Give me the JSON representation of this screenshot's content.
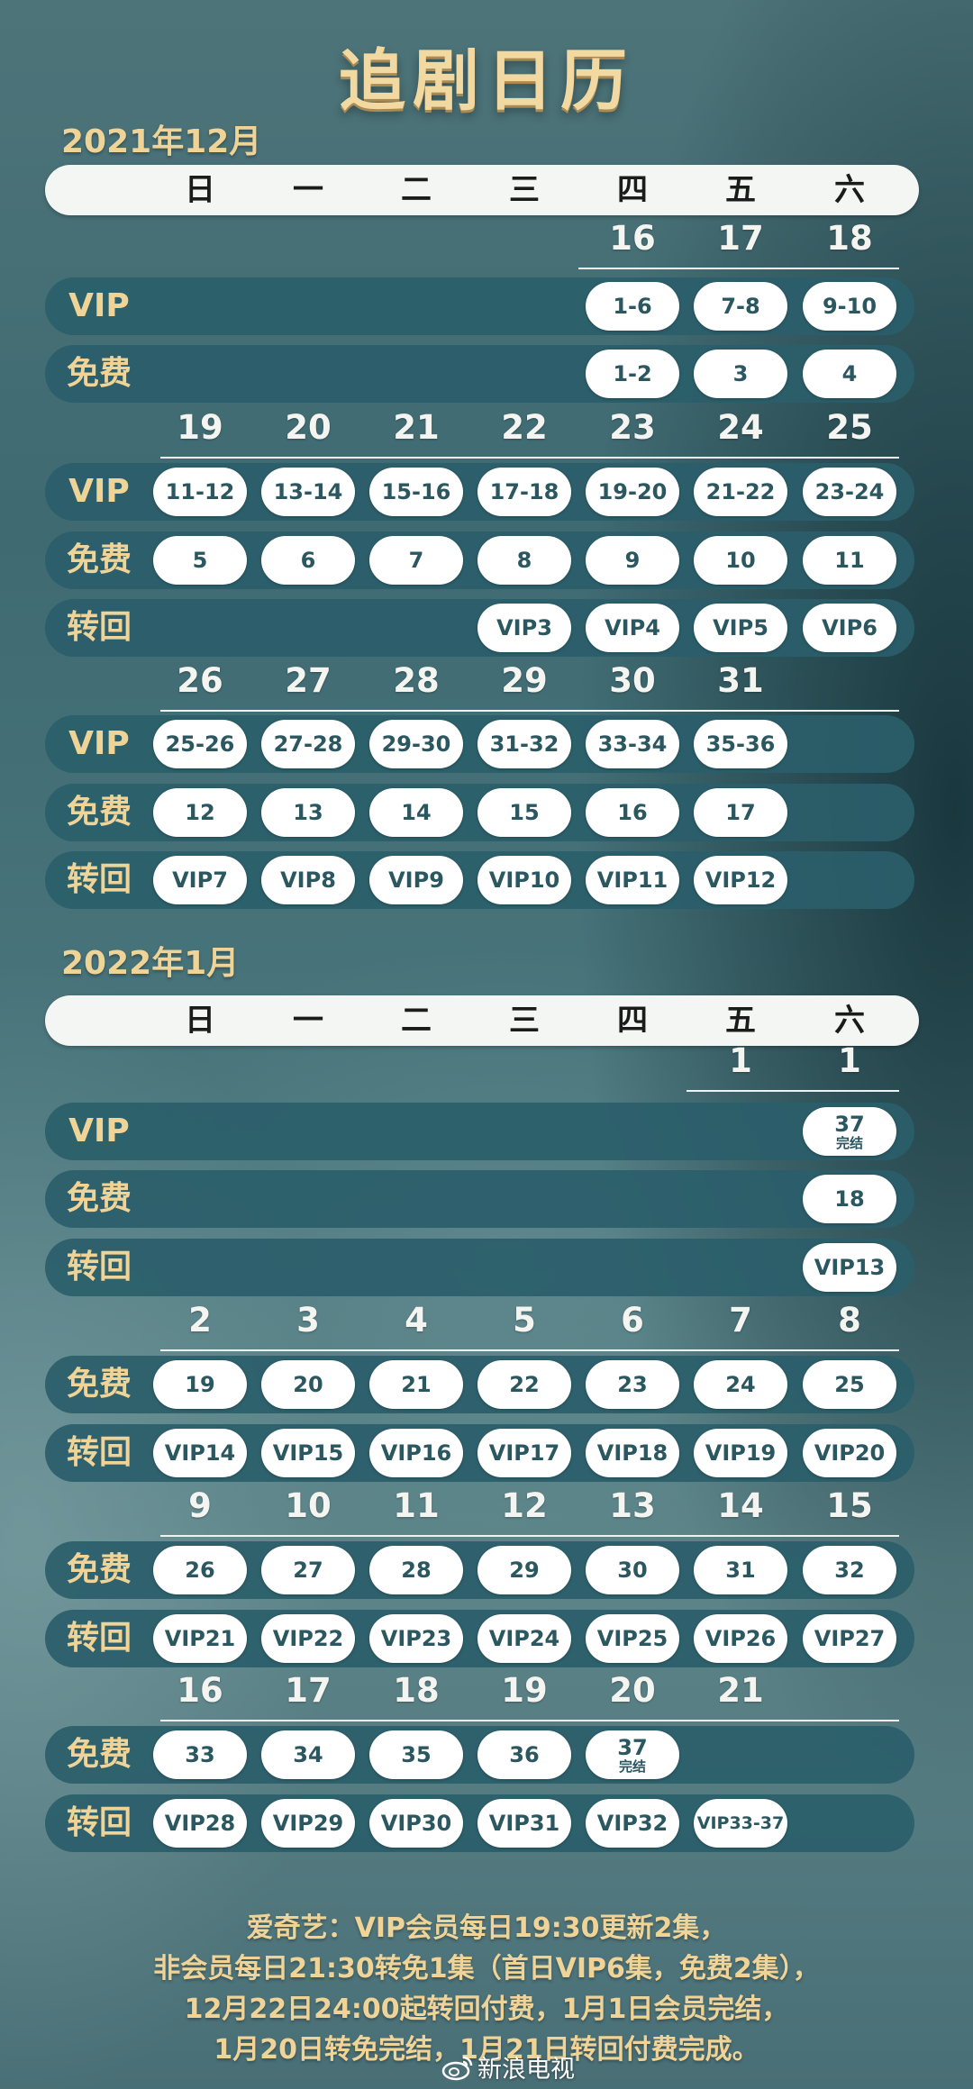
{
  "title": "追剧日历",
  "weekdays": [
    "日",
    "一",
    "二",
    "三",
    "四",
    "五",
    "六"
  ],
  "months": [
    {
      "label": "2021年12月",
      "weeks": [
        {
          "dates": [
            "",
            "",
            "",
            "",
            "16",
            "17",
            "18"
          ],
          "rows": [
            {
              "label": "VIP",
              "cells": [
                "",
                "",
                "",
                "",
                "1-6",
                "7-8",
                "9-10"
              ]
            },
            {
              "label": "免费",
              "cells": [
                "",
                "",
                "",
                "",
                "1-2",
                "3",
                "4"
              ]
            }
          ]
        },
        {
          "dates": [
            "19",
            "20",
            "21",
            "22",
            "23",
            "24",
            "25"
          ],
          "rows": [
            {
              "label": "VIP",
              "cells": [
                "11-12",
                "13-14",
                "15-16",
                "17-18",
                "19-20",
                "21-22",
                "23-24"
              ]
            },
            {
              "label": "免费",
              "cells": [
                "5",
                "6",
                "7",
                "8",
                "9",
                "10",
                "11"
              ]
            },
            {
              "label": "转回",
              "cells": [
                "",
                "",
                "",
                "VIP3",
                "VIP4",
                "VIP5",
                "VIP6"
              ]
            }
          ]
        },
        {
          "dates": [
            "26",
            "27",
            "28",
            "29",
            "30",
            "31",
            ""
          ],
          "rows": [
            {
              "label": "VIP",
              "cells": [
                "25-26",
                "27-28",
                "29-30",
                "31-32",
                "33-34",
                "35-36",
                ""
              ]
            },
            {
              "label": "免费",
              "cells": [
                "12",
                "13",
                "14",
                "15",
                "16",
                "17",
                ""
              ]
            },
            {
              "label": "转回",
              "cells": [
                "VIP7",
                "VIP8",
                "VIP9",
                "VIP10",
                "VIP11",
                "VIP12",
                ""
              ]
            }
          ]
        }
      ]
    },
    {
      "label": "2022年1月",
      "weeks": [
        {
          "dates": [
            "",
            "",
            "",
            "",
            "",
            "1",
            "1"
          ],
          "rows": [
            {
              "label": "VIP",
              "cells": [
                "",
                "",
                "",
                "",
                "",
                "",
                "37"
              ],
              "subs": [
                "",
                "",
                "",
                "",
                "",
                "",
                "完结"
              ]
            },
            {
              "label": "免费",
              "cells": [
                "",
                "",
                "",
                "",
                "",
                "",
                "18"
              ]
            },
            {
              "label": "转回",
              "cells": [
                "",
                "",
                "",
                "",
                "",
                "",
                "VIP13"
              ]
            }
          ]
        },
        {
          "dates": [
            "2",
            "3",
            "4",
            "5",
            "6",
            "7",
            "8"
          ],
          "rows": [
            {
              "label": "免费",
              "cells": [
                "19",
                "20",
                "21",
                "22",
                "23",
                "24",
                "25"
              ]
            },
            {
              "label": "转回",
              "cells": [
                "VIP14",
                "VIP15",
                "VIP16",
                "VIP17",
                "VIP18",
                "VIP19",
                "VIP20"
              ]
            }
          ]
        },
        {
          "dates": [
            "9",
            "10",
            "11",
            "12",
            "13",
            "14",
            "15"
          ],
          "rows": [
            {
              "label": "免费",
              "cells": [
                "26",
                "27",
                "28",
                "29",
                "30",
                "31",
                "32"
              ]
            },
            {
              "label": "转回",
              "cells": [
                "VIP21",
                "VIP22",
                "VIP23",
                "VIP24",
                "VIP25",
                "VIP26",
                "VIP27"
              ]
            }
          ]
        },
        {
          "dates": [
            "16",
            "17",
            "18",
            "19",
            "20",
            "21",
            ""
          ],
          "rows": [
            {
              "label": "免费",
              "cells": [
                "33",
                "34",
                "35",
                "36",
                "37",
                "",
                ""
              ],
              "subs": [
                "",
                "",
                "",
                "",
                "完结",
                "",
                ""
              ]
            },
            {
              "label": "转回",
              "cells": [
                "VIP28",
                "VIP29",
                "VIP30",
                "VIP31",
                "VIP32",
                "VIP33-37",
                ""
              ]
            }
          ]
        }
      ]
    }
  ],
  "notes": [
    "爱奇艺：VIP会员每日19:30更新2集，",
    "非会员每日21:30转免1集（首日VIP6集，免费2集），",
    "12月22日24:00起转回付费，1月1日会员完结，",
    "1月20日转免完结，1月21日转回付费完成。"
  ],
  "watermark": "新浪电视",
  "colors": {
    "accent_gold": "#f0d497",
    "band": "#2a5e6a",
    "pill_text": "#2b5760"
  }
}
